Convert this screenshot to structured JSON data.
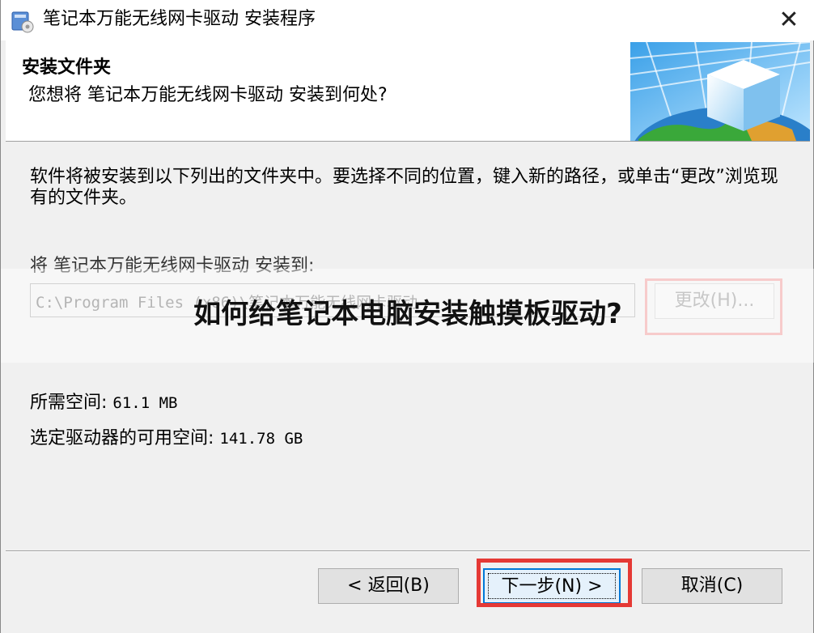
{
  "window": {
    "title": "笔记本万能无线网卡驱动 安装程序",
    "close_glyph": "✕"
  },
  "header": {
    "title": "安装文件夹",
    "subtitle": "您想将 笔记本万能无线网卡驱动 安装到何处?"
  },
  "content": {
    "description": "软件将被安装到以下列出的文件夹中。要选择不同的位置，键入新的路径，或单击“更改”浏览现有的文件夹。",
    "install_label": "将 笔记本万能无线网卡驱动 安装到:",
    "path_value": "C:\\Program Files (x86)\\笔记本万能无线网卡驱动",
    "change_button": "更改(H)...",
    "space_required_label": "所需空间:",
    "space_required_value": "61.1 MB",
    "space_free_label": "选定驱动器的可用空间:",
    "space_free_value": "141.78 GB"
  },
  "overlay": {
    "text": "如何给笔记本电脑安装触摸板驱动?"
  },
  "footer": {
    "back_button": "< 返回(B)",
    "next_button": "下一步(N) >",
    "cancel_button": "取消(C)"
  },
  "colors": {
    "highlight_red": "#e53935",
    "highlight_pink": "#f0a0a0",
    "focus_blue": "#0078d7"
  }
}
